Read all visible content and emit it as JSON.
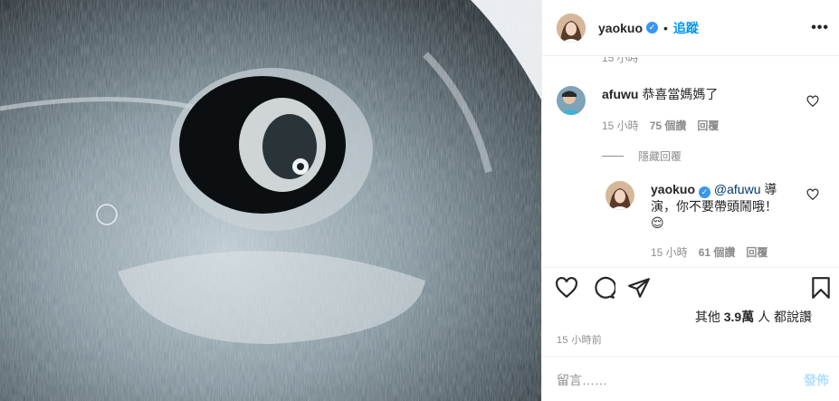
{
  "post": {
    "author": "yaokuo",
    "follow_label": "追蹤",
    "separator": "•",
    "more_icon": "more-horizontal-icon",
    "verified_icon": "verified-badge-icon",
    "likes_prefix": "其他",
    "likes_count": "3.9萬",
    "likes_suffix": "人 都說讚",
    "posted_time": "15 小時前"
  },
  "comments": {
    "clipped_time": "15 小時",
    "items": [
      {
        "user": "afuwu",
        "text": "恭喜當媽媽了",
        "time": "15 小時",
        "likes": "75 個讚",
        "reply_label": "回覆"
      }
    ],
    "hide_replies_label": "隱藏回覆",
    "replies": [
      {
        "user": "yaokuo",
        "mention": "@afuwu",
        "text": " 導演，你不要帶頭鬧哦！",
        "emoji": "😌",
        "time": "15 小時",
        "likes": "61 個讚",
        "reply_label": "回覆"
      }
    ]
  },
  "composer": {
    "placeholder": "留言……",
    "post_label": "發佈"
  },
  "colors": {
    "accent": "#0095f6",
    "verified": "#3897f0",
    "muted": "#8e8e8e",
    "post_disabled": "#b2dffc"
  }
}
